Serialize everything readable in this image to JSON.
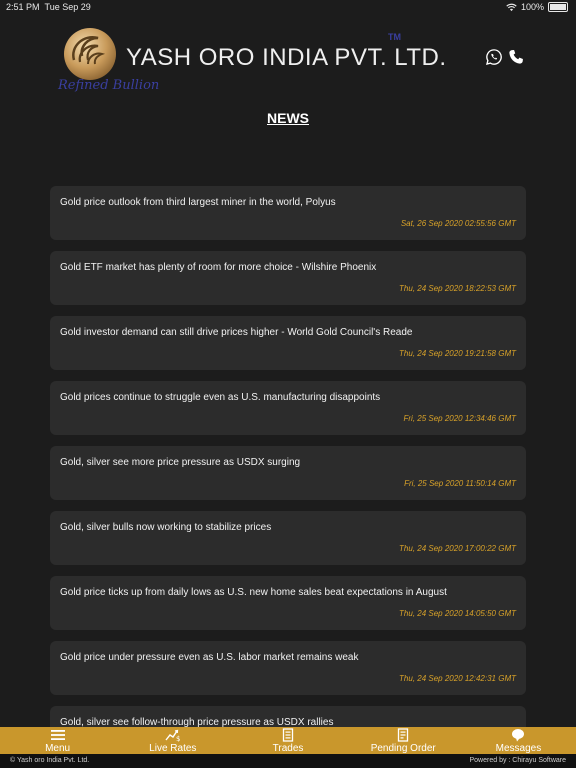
{
  "status_bar": {
    "time": "2:51 PM",
    "date": "Tue Sep 29",
    "battery": "100%"
  },
  "header": {
    "brand_name": "YASH ORO INDIA PVT. LTD.",
    "tm": "TM",
    "tagline": "Refined Bullion",
    "icons": [
      "whatsapp-icon",
      "phone-icon"
    ]
  },
  "page_title": "NEWS",
  "news": [
    {
      "title": "Gold price outlook from third largest miner in the world, Polyus",
      "date": "Sat, 26 Sep 2020 02:55:56 GMT"
    },
    {
      "title": "Gold ETF market has plenty of room for more choice - Wilshire Phoenix",
      "date": "Thu, 24 Sep 2020 18:22:53 GMT"
    },
    {
      "title": "Gold investor demand can still drive prices higher - World Gold Council's Reade",
      "date": "Thu, 24 Sep 2020 19:21:58 GMT"
    },
    {
      "title": "Gold prices continue to struggle even as U.S. manufacturing disappoints",
      "date": "Fri, 25 Sep 2020 12:34:46 GMT"
    },
    {
      "title": "Gold, silver see more price pressure as USDX surging",
      "date": "Fri, 25 Sep 2020 11:50:14 GMT"
    },
    {
      "title": "Gold, silver bulls now working to stabilize prices",
      "date": "Thu, 24 Sep 2020 17:00:22 GMT"
    },
    {
      "title": "Gold price ticks up from daily lows as U.S. new home sales beat expectations in August",
      "date": "Thu, 24 Sep 2020 14:05:50 GMT"
    },
    {
      "title": "Gold price under pressure even as U.S. labor market remains weak",
      "date": "Thu, 24 Sep 2020 12:42:31 GMT"
    },
    {
      "title": "Gold, silver see follow-through price pressure as USDX rallies",
      "date": ""
    }
  ],
  "nav": {
    "menu": "Menu",
    "live_rates": "Live Rates",
    "trades": "Trades",
    "pending_order": "Pending Order",
    "messages": "Messages"
  },
  "footer": {
    "left": "© Yash oro India Pvt. Ltd.",
    "right": "Powered by : Chirayu Software"
  },
  "colors": {
    "background": "#1c1c1c",
    "card": "#2c2c2c",
    "accent_gold": "#c9972c",
    "date_gold": "#d8a229"
  }
}
